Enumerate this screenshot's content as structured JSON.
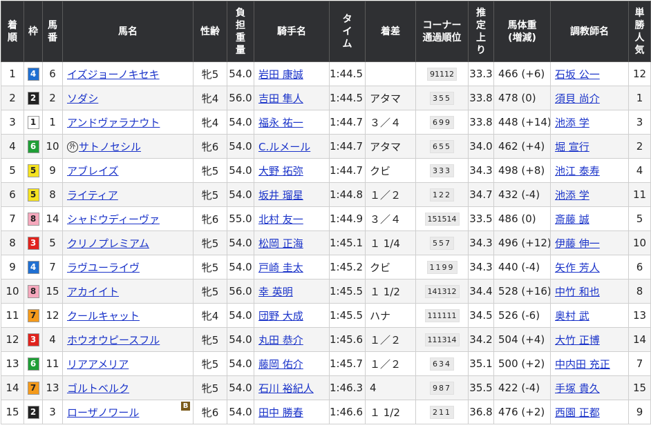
{
  "headers": [
    "着順",
    "枠",
    "馬番",
    "馬名",
    "性齢",
    "負担重量",
    "騎手名",
    "タイム",
    "着差",
    "コーナー通過順位",
    "推定上り",
    "馬体重(増減)",
    "調教師名",
    "単勝人気"
  ],
  "header_lines": {
    "rank": [
      "着",
      "順"
    ],
    "waku": [
      "枠"
    ],
    "umaban": [
      "馬",
      "番"
    ],
    "horse": [
      "馬名"
    ],
    "sexage": [
      "性齢"
    ],
    "weight": [
      "負",
      "担",
      "重",
      "量"
    ],
    "jockey": [
      "騎手名"
    ],
    "time": [
      "タ",
      "イ",
      "ム"
    ],
    "margin": [
      "着差"
    ],
    "corner": [
      "コーナー",
      "通過順位"
    ],
    "agari": [
      "推",
      "定",
      "上",
      "り"
    ],
    "bodyweight": [
      "馬体重",
      "(増減)"
    ],
    "trainer": [
      "調教師名"
    ],
    "pop": [
      "単",
      "勝",
      "人",
      "気"
    ]
  },
  "colors": {
    "waku_1": "#ffffff",
    "waku_2": "#222222",
    "waku_3": "#e0231d",
    "waku_4": "#1f6fd1",
    "waku_5": "#f5e320",
    "waku_6": "#1f9e36",
    "waku_7": "#f49a1b",
    "waku_8": "#f6a8bd",
    "header_bg": "#2f3033",
    "link": "#1a33c9"
  },
  "rows": [
    {
      "rank": "1",
      "waku": "4",
      "umaban": "6",
      "prefix": "",
      "horse": "イズジョーノキセキ",
      "blinker": "",
      "sexage": "牝5",
      "weight": "54.0",
      "jockey": "岩田 康誠",
      "time": "1:44.5",
      "margin": "",
      "corner": "91112",
      "agari": "33.3",
      "bodyweight": "466 (+6)",
      "trainer": "石坂 公一",
      "pop": "12"
    },
    {
      "rank": "2",
      "waku": "2",
      "umaban": "2",
      "prefix": "",
      "horse": "ソダシ",
      "blinker": "",
      "sexage": "牝4",
      "weight": "56.0",
      "jockey": "吉田 隼人",
      "time": "1:44.5",
      "margin": "アタマ",
      "corner": "355",
      "agari": "33.8",
      "bodyweight": "478 (0)",
      "trainer": "須貝 尚介",
      "pop": "1"
    },
    {
      "rank": "3",
      "waku": "1",
      "umaban": "1",
      "prefix": "",
      "horse": "アンドヴァラナウト",
      "blinker": "",
      "sexage": "牝4",
      "weight": "54.0",
      "jockey": "福永 祐一",
      "time": "1:44.7",
      "margin": "３／４",
      "corner": "699",
      "agari": "33.8",
      "bodyweight": "448 (+14)",
      "trainer": "池添 学",
      "pop": "3"
    },
    {
      "rank": "4",
      "waku": "6",
      "umaban": "10",
      "prefix": "外",
      "horse": "サトノセシル",
      "blinker": "",
      "sexage": "牝6",
      "weight": "54.0",
      "jockey": "C.ルメール",
      "time": "1:44.7",
      "margin": "アタマ",
      "corner": "655",
      "agari": "34.0",
      "bodyweight": "462 (+4)",
      "trainer": "堀 宣行",
      "pop": "2"
    },
    {
      "rank": "5",
      "waku": "5",
      "umaban": "9",
      "prefix": "",
      "horse": "アブレイズ",
      "blinker": "",
      "sexage": "牝5",
      "weight": "54.0",
      "jockey": "大野 拓弥",
      "time": "1:44.7",
      "margin": "クビ",
      "corner": "333",
      "agari": "34.3",
      "bodyweight": "498 (+8)",
      "trainer": "池江 泰寿",
      "pop": "4"
    },
    {
      "rank": "6",
      "waku": "5",
      "umaban": "8",
      "prefix": "",
      "horse": "ライティア",
      "blinker": "",
      "sexage": "牝5",
      "weight": "54.0",
      "jockey": "坂井 瑠星",
      "time": "1:44.8",
      "margin": "１／２",
      "corner": "122",
      "agari": "34.7",
      "bodyweight": "432 (-4)",
      "trainer": "池添 学",
      "pop": "11"
    },
    {
      "rank": "7",
      "waku": "8",
      "umaban": "14",
      "prefix": "",
      "horse": "シャドウディーヴァ",
      "blinker": "",
      "sexage": "牝6",
      "weight": "55.0",
      "jockey": "北村 友一",
      "time": "1:44.9",
      "margin": "３／４",
      "corner": "151514",
      "agari": "33.5",
      "bodyweight": "486 (0)",
      "trainer": "斎藤 誠",
      "pop": "5"
    },
    {
      "rank": "8",
      "waku": "3",
      "umaban": "5",
      "prefix": "",
      "horse": "クリノプレミアム",
      "blinker": "",
      "sexage": "牝5",
      "weight": "54.0",
      "jockey": "松岡 正海",
      "time": "1:45.1",
      "margin": "１ 1/4",
      "corner": "557",
      "agari": "34.3",
      "bodyweight": "496 (+12)",
      "trainer": "伊藤 伸一",
      "pop": "10"
    },
    {
      "rank": "9",
      "waku": "4",
      "umaban": "7",
      "prefix": "",
      "horse": "ラヴユーライヴ",
      "blinker": "",
      "sexage": "牝5",
      "weight": "54.0",
      "jockey": "戸崎 圭太",
      "time": "1:45.2",
      "margin": "クビ",
      "corner": "1199",
      "agari": "34.3",
      "bodyweight": "440 (-4)",
      "trainer": "矢作 芳人",
      "pop": "6"
    },
    {
      "rank": "10",
      "waku": "8",
      "umaban": "15",
      "prefix": "",
      "horse": "アカイイト",
      "blinker": "",
      "sexage": "牝5",
      "weight": "56.0",
      "jockey": "幸 英明",
      "time": "1:45.5",
      "margin": "１ 1/2",
      "corner": "141312",
      "agari": "34.4",
      "bodyweight": "528 (+16)",
      "trainer": "中竹 和也",
      "pop": "8"
    },
    {
      "rank": "11",
      "waku": "7",
      "umaban": "12",
      "prefix": "",
      "horse": "クールキャット",
      "blinker": "",
      "sexage": "牝4",
      "weight": "54.0",
      "jockey": "団野 大成",
      "time": "1:45.5",
      "margin": "ハナ",
      "corner": "111111",
      "agari": "34.5",
      "bodyweight": "526 (-6)",
      "trainer": "奥村 武",
      "pop": "13"
    },
    {
      "rank": "12",
      "waku": "3",
      "umaban": "4",
      "prefix": "",
      "horse": "ホウオウピースフル",
      "blinker": "",
      "sexage": "牝5",
      "weight": "54.0",
      "jockey": "丸田 恭介",
      "time": "1:45.6",
      "margin": "１／２",
      "corner": "111314",
      "agari": "34.2",
      "bodyweight": "504 (+4)",
      "trainer": "大竹 正博",
      "pop": "14"
    },
    {
      "rank": "13",
      "waku": "6",
      "umaban": "11",
      "prefix": "",
      "horse": "リアアメリア",
      "blinker": "",
      "sexage": "牝5",
      "weight": "54.0",
      "jockey": "藤岡 佑介",
      "time": "1:45.7",
      "margin": "１／２",
      "corner": "634",
      "agari": "35.1",
      "bodyweight": "500 (+2)",
      "trainer": "中内田 充正",
      "pop": "7"
    },
    {
      "rank": "14",
      "waku": "7",
      "umaban": "13",
      "prefix": "",
      "horse": "ゴルトベルク",
      "blinker": "",
      "sexage": "牝5",
      "weight": "54.0",
      "jockey": "石川 裕紀人",
      "time": "1:46.3",
      "margin": "4",
      "corner": "987",
      "agari": "35.5",
      "bodyweight": "422 (-4)",
      "trainer": "手塚 貴久",
      "pop": "15"
    },
    {
      "rank": "15",
      "waku": "2",
      "umaban": "3",
      "prefix": "",
      "horse": "ローザノワール",
      "blinker": "B",
      "sexage": "牝6",
      "weight": "54.0",
      "jockey": "田中 勝春",
      "time": "1:46.6",
      "margin": "１ 1/2",
      "corner": "211",
      "agari": "36.8",
      "bodyweight": "476 (+2)",
      "trainer": "西園 正都",
      "pop": "9"
    }
  ]
}
